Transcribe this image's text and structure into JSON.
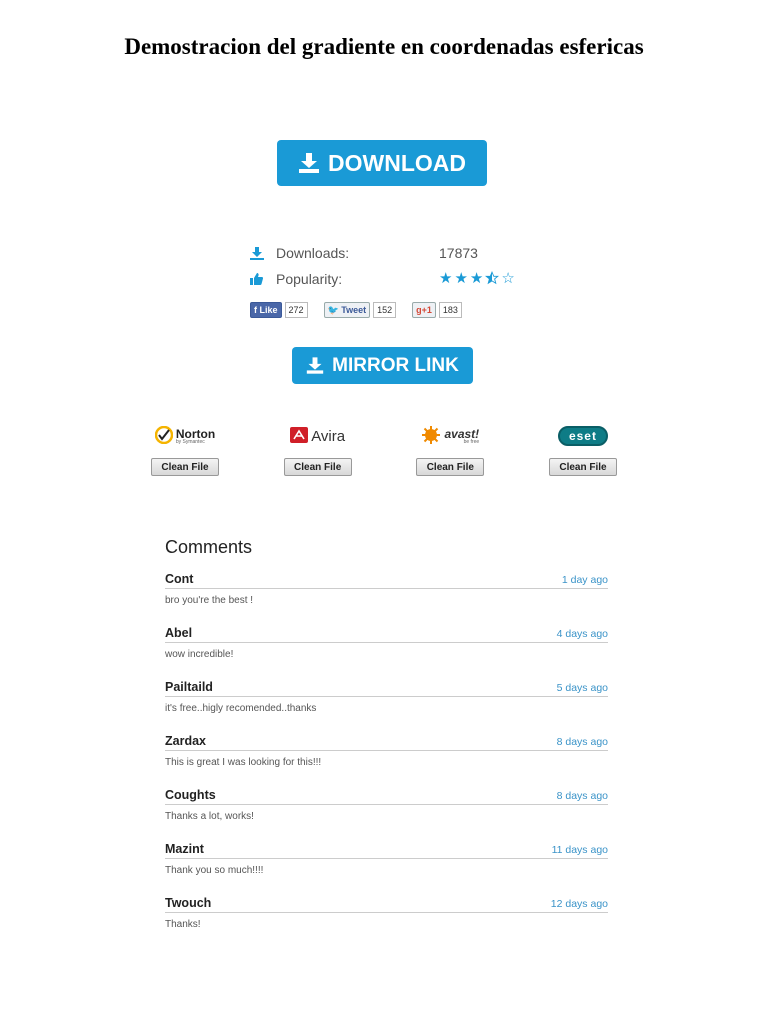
{
  "page": {
    "title": "Demostracion del gradiente en coordenadas esfericas"
  },
  "download_button": {
    "label": "DOWNLOAD"
  },
  "stats": {
    "downloads_label": "Downloads:",
    "downloads_value": "17873",
    "popularity_label": "Popularity:",
    "popularity_stars": 3.5,
    "popularity_max": 5
  },
  "social": {
    "facebook": {
      "label": "Like",
      "count": "272"
    },
    "twitter": {
      "label": "Tweet",
      "count": "152"
    },
    "google": {
      "label": "+1",
      "count": "183"
    }
  },
  "mirror_button": {
    "label": "MIRROR LINK"
  },
  "antivirus": [
    {
      "name": "Norton",
      "sub": "by Symantec",
      "icon": "norton-check-icon",
      "status": "Clean File"
    },
    {
      "name": "Avira",
      "icon": "avira-umbrella-icon",
      "status": "Clean File"
    },
    {
      "name": "avast!",
      "sub": "be free",
      "icon": "avast-ball-icon",
      "status": "Clean File"
    },
    {
      "name": "eset",
      "icon": "eset-badge-icon",
      "status": "Clean File"
    }
  ],
  "comments": {
    "heading": "Comments",
    "items": [
      {
        "author": "Cont",
        "time": "1 day ago",
        "text": "bro you're the best !"
      },
      {
        "author": "Abel",
        "time": "4 days ago",
        "text": "wow incredible!"
      },
      {
        "author": "Pailtaild",
        "time": "5 days ago",
        "text": "it's free..higly recomended..thanks"
      },
      {
        "author": "Zardax",
        "time": "8 days ago",
        "text": "This is great I was looking for this!!!"
      },
      {
        "author": "Coughts",
        "time": "8 days ago",
        "text": "Thanks a lot, works!"
      },
      {
        "author": "Mazint",
        "time": "11 days ago",
        "text": "Thank you so much!!!!"
      },
      {
        "author": "Twouch",
        "time": "12 days ago",
        "text": "Thanks!"
      }
    ]
  },
  "colors": {
    "accent": "#1a9ad6",
    "link": "#3a93c8"
  }
}
